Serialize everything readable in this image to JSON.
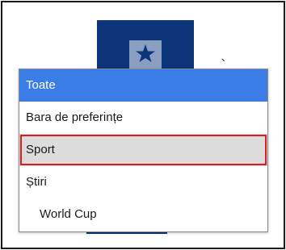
{
  "dropdown": {
    "items": [
      {
        "label": "Toate"
      },
      {
        "label": "Bara de preferințe"
      },
      {
        "label": "Sport"
      },
      {
        "label": "Știri"
      },
      {
        "label": "World Cup"
      }
    ],
    "selected_index": 0,
    "highlighted_index": 2
  },
  "colors": {
    "selected_bg": "#3b7de6",
    "highlight_outline": "#e0191e",
    "hover_bg": "#dcdcdc",
    "tile_bg": "#0b3578"
  },
  "icons": {
    "tile_icon": "star-icon"
  }
}
